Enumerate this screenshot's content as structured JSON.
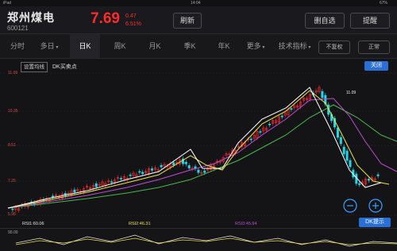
{
  "statusbar": {
    "device": "iPad",
    "time": "14:04",
    "battery": "67%"
  },
  "stock": {
    "name": "郑州煤电",
    "code": "600121",
    "price": "7.69",
    "change": "0.47",
    "change_pct": "6.51%"
  },
  "header_buttons": {
    "refresh": "刷新",
    "watchlist_delete": "删自选",
    "alert": "提醒"
  },
  "tabs": [
    "分时",
    "多日",
    "日K",
    "周K",
    "月K",
    "季K",
    "年K",
    "更多",
    "技术指标"
  ],
  "active_tab": "日K",
  "tab_buttons": {
    "no_adjust": "不复权",
    "compare": "正常"
  },
  "chart_controls": {
    "ma_settings": "设置均线",
    "dk_label": "DK买卖点",
    "close": "关闭",
    "dk_hint": "DK提示"
  },
  "y_axis": {
    "top": "11.09",
    "mid_high": "10.35",
    "mid": "8.51",
    "mid_low": "7.25",
    "bottom": "5.98"
  },
  "rsi": {
    "rsi1": "RSI1:60.06",
    "rsi2": "RSI2:46.31",
    "rsi3": "RSI3:45.94"
  },
  "bottom_panel": {
    "label": "90.00"
  },
  "colors": {
    "up": "#ff2b2b",
    "down": "#21d7e8",
    "ma5": "#ffffff",
    "ma10": "#f0e24a",
    "ma20": "#c04cd6",
    "ma30": "#47b84a",
    "accent": "#2a6fd6"
  }
}
